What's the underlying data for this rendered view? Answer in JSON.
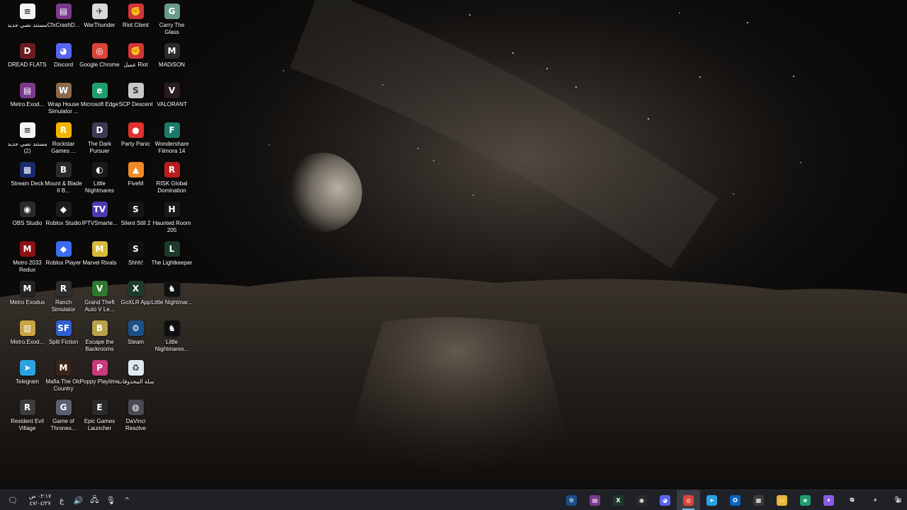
{
  "desktop": {
    "icons": [
      {
        "label": "مستند نصي جديد",
        "icon": "text-document-icon",
        "color": "#f4f4f4",
        "glyph": "≡"
      },
      {
        "label": "DREAD FLATS",
        "icon": "dread-flats-icon",
        "color": "#6b1d1d",
        "glyph": "D"
      },
      {
        "label": "Metro.Exod...",
        "icon": "winrar-icon",
        "color": "#7a3a8c",
        "glyph": "▤"
      },
      {
        "label": "مستند نصي جديد (2)",
        "icon": "text-document-icon",
        "color": "#f4f4f4",
        "glyph": "≡"
      },
      {
        "label": "Stream Deck",
        "icon": "stream-deck-icon",
        "color": "#1b2a6e",
        "glyph": "▦"
      },
      {
        "label": "OBS Studio",
        "icon": "obs-icon",
        "color": "#2a2a2a",
        "glyph": "◉"
      },
      {
        "label": "Metro 2033 Redux",
        "icon": "metro-2033-icon",
        "color": "#8c1111",
        "glyph": "M"
      },
      {
        "label": "Metro Exodus",
        "icon": "metro-exodus-icon",
        "color": "#222222",
        "glyph": "M"
      },
      {
        "label": "Metro.Exod...",
        "icon": "archive-icon",
        "color": "#c9a441",
        "glyph": "▥"
      },
      {
        "label": "Telegram",
        "icon": "telegram-icon",
        "color": "#2aa3e0",
        "glyph": "➤"
      },
      {
        "label": "Resident Evil Village",
        "icon": "resident-evil-icon",
        "color": "#3c3c3c",
        "glyph": "R"
      },
      {
        "label": "CfxCrashD...",
        "icon": "winrar-icon",
        "color": "#7a3a8c",
        "glyph": "▤"
      },
      {
        "label": "Discord",
        "icon": "discord-icon",
        "color": "#5865f2",
        "glyph": "◕"
      },
      {
        "label": "Wrap House Simulator ...",
        "icon": "wrap-house-icon",
        "color": "#8a6a4a",
        "glyph": "W"
      },
      {
        "label": "Rockstar Games ...",
        "icon": "rockstar-icon",
        "color": "#f3b400",
        "glyph": "R"
      },
      {
        "label": "Mount & Blade II B...",
        "icon": "mount-blade-icon",
        "color": "#2b2b2b",
        "glyph": "B"
      },
      {
        "label": "Roblox Studio",
        "icon": "roblox-studio-icon",
        "color": "#1c1c1c",
        "glyph": "◆"
      },
      {
        "label": "Roblox Player",
        "icon": "roblox-player-icon",
        "color": "#3b6cf2",
        "glyph": "◆"
      },
      {
        "label": "Ranch Simulator",
        "icon": "ranch-simulator-icon",
        "color": "#2f2f2f",
        "glyph": "R"
      },
      {
        "label": "Split Fiction",
        "icon": "split-fiction-icon",
        "color": "#2f5fd0",
        "glyph": "SF"
      },
      {
        "label": "Mafia The Old Country",
        "icon": "mafia-icon",
        "color": "#3a2418",
        "glyph": "M"
      },
      {
        "label": "Game of Thrones...",
        "icon": "game-of-thrones-icon",
        "color": "#5a6070",
        "glyph": "G"
      },
      {
        "label": "WarThunder",
        "icon": "war-thunder-icon",
        "color": "#d9d9d9",
        "glyph": "✈"
      },
      {
        "label": "Google Chrome",
        "icon": "chrome-icon",
        "color": "#db4437",
        "glyph": "◎"
      },
      {
        "label": "Microsoft Edge",
        "icon": "edge-icon",
        "color": "#1e9e6e",
        "glyph": "e"
      },
      {
        "label": "The Dark Pursuer",
        "icon": "dark-pursuer-icon",
        "color": "#3b3b55",
        "glyph": "D"
      },
      {
        "label": "Little Nightmares",
        "icon": "little-nightmares-icon",
        "color": "#1a1a1a",
        "glyph": "◐"
      },
      {
        "label": "IPTVSmarte...",
        "icon": "iptv-smarters-icon",
        "color": "#4b3bb0",
        "glyph": "TV"
      },
      {
        "label": "Marvel Rivals",
        "icon": "marvel-rivals-icon",
        "color": "#d8b93a",
        "glyph": "M"
      },
      {
        "label": "Grand Theft Auto V Le...",
        "icon": "gta-v-icon",
        "color": "#2d7a2d",
        "glyph": "V"
      },
      {
        "label": "Escape the Backrooms",
        "icon": "backrooms-icon",
        "color": "#b8a24a",
        "glyph": "B"
      },
      {
        "label": "Poppy Playtime",
        "icon": "poppy-playtime-icon",
        "color": "#c83b7a",
        "glyph": "P"
      },
      {
        "label": "Epic Games Launcher",
        "icon": "epic-games-icon",
        "color": "#2a2a2a",
        "glyph": "E"
      },
      {
        "label": "Riot Client",
        "icon": "riot-client-icon",
        "color": "#d13639",
        "glyph": "✊"
      },
      {
        "label": "عميل Riot",
        "icon": "riot-client-icon",
        "color": "#d13639",
        "glyph": "✊"
      },
      {
        "label": "SCP Descent",
        "icon": "scp-descent-icon",
        "color": "#c9c9c9",
        "glyph": "S"
      },
      {
        "label": "Party Panic",
        "icon": "party-panic-icon",
        "color": "#e0302f",
        "glyph": "●"
      },
      {
        "label": "FiveM",
        "icon": "fivem-icon",
        "color": "#f08a24",
        "glyph": "▲"
      },
      {
        "label": "Silent Still 2",
        "icon": "silent-still-icon",
        "color": "#151515",
        "glyph": "S"
      },
      {
        "label": "Shhh!",
        "icon": "shhh-icon",
        "color": "#121212",
        "glyph": "S"
      },
      {
        "label": "GoXLR App",
        "icon": "goxlr-icon",
        "color": "#1d3b2a",
        "glyph": "X"
      },
      {
        "label": "Steam",
        "icon": "steam-icon",
        "color": "#1b4f87",
        "glyph": "⚙"
      },
      {
        "label": "سلة المحذوفات",
        "icon": "recycle-bin-icon",
        "color": "#dfe8f0",
        "glyph": "♻"
      },
      {
        "label": "DaVinci Resolve",
        "icon": "davinci-resolve-icon",
        "color": "#4a4a55",
        "glyph": "◍"
      },
      {
        "label": "Carry The Glass",
        "icon": "carry-the-glass-icon",
        "color": "#6a9a8a",
        "glyph": "G"
      },
      {
        "label": "MADiSON",
        "icon": "madison-icon",
        "color": "#2a2a2a",
        "glyph": "M"
      },
      {
        "label": "VALORANT",
        "icon": "valorant-icon",
        "color": "#2a1a22",
        "glyph": "V"
      },
      {
        "label": "Wondershare Filmora 14",
        "icon": "filmora-icon",
        "color": "#1a7a6a",
        "glyph": "F"
      },
      {
        "label": "RISK Global Domination",
        "icon": "risk-icon",
        "color": "#b81c1c",
        "glyph": "R"
      },
      {
        "label": "Haunted Room 205",
        "icon": "haunted-room-icon",
        "color": "#1a1a1a",
        "glyph": "H"
      },
      {
        "label": "The Lightkeeper",
        "icon": "lightkeeper-icon",
        "color": "#1e3a2a",
        "glyph": "L"
      },
      {
        "label": "Little Nightmar...",
        "icon": "little-nightmares-ii-icon",
        "color": "#101010",
        "glyph": "♞"
      },
      {
        "label": "Little Nightmares...",
        "icon": "little-nightmares-iii-icon",
        "color": "#101010",
        "glyph": "♞"
      }
    ]
  },
  "taskbar": {
    "clock_time": "٠٢:١٧ ص",
    "clock_date": "٤٧/٠٤/٢٧",
    "language": "ع",
    "apps": [
      {
        "name": "steam",
        "icon": "steam-icon",
        "color": "#1b4f87",
        "glyph": "⚙",
        "active": false
      },
      {
        "name": "winrar",
        "icon": "winrar-icon",
        "color": "#7a3a8c",
        "glyph": "▤",
        "active": false
      },
      {
        "name": "goxlr",
        "icon": "goxlr-icon",
        "color": "#1d3b2a",
        "glyph": "X",
        "active": false
      },
      {
        "name": "obs",
        "icon": "obs-icon",
        "color": "#2a2a2a",
        "glyph": "◉",
        "active": false
      },
      {
        "name": "discord",
        "icon": "discord-icon",
        "color": "#5865f2",
        "glyph": "◕",
        "active": false
      },
      {
        "name": "chrome",
        "icon": "chrome-icon",
        "color": "#db4437",
        "glyph": "◎",
        "active": true
      },
      {
        "name": "telegram",
        "icon": "telegram-icon",
        "color": "#2aa3e0",
        "glyph": "➤",
        "active": false
      },
      {
        "name": "outlook",
        "icon": "outlook-icon",
        "color": "#0a64c2",
        "glyph": "O",
        "active": false
      },
      {
        "name": "store",
        "icon": "microsoft-store-icon",
        "color": "#3b3b3b",
        "glyph": "▦",
        "active": false
      },
      {
        "name": "file-explorer",
        "icon": "file-explorer-icon",
        "color": "#e8b63a",
        "glyph": "▭",
        "active": false
      },
      {
        "name": "edge",
        "icon": "edge-icon",
        "color": "#1e9e6e",
        "glyph": "e",
        "active": false
      },
      {
        "name": "copilot",
        "icon": "copilot-icon",
        "color": "#8a5ae8",
        "glyph": "✦",
        "active": false
      },
      {
        "name": "task-view",
        "icon": "task-view-icon",
        "color": "#1f2126",
        "glyph": "⧉",
        "active": false
      },
      {
        "name": "search",
        "icon": "search-icon",
        "color": "#1f2126",
        "glyph": "⌕",
        "active": false
      },
      {
        "name": "start",
        "icon": "start-icon",
        "color": "#1f2126",
        "glyph": "⊞",
        "active": false
      }
    ]
  }
}
